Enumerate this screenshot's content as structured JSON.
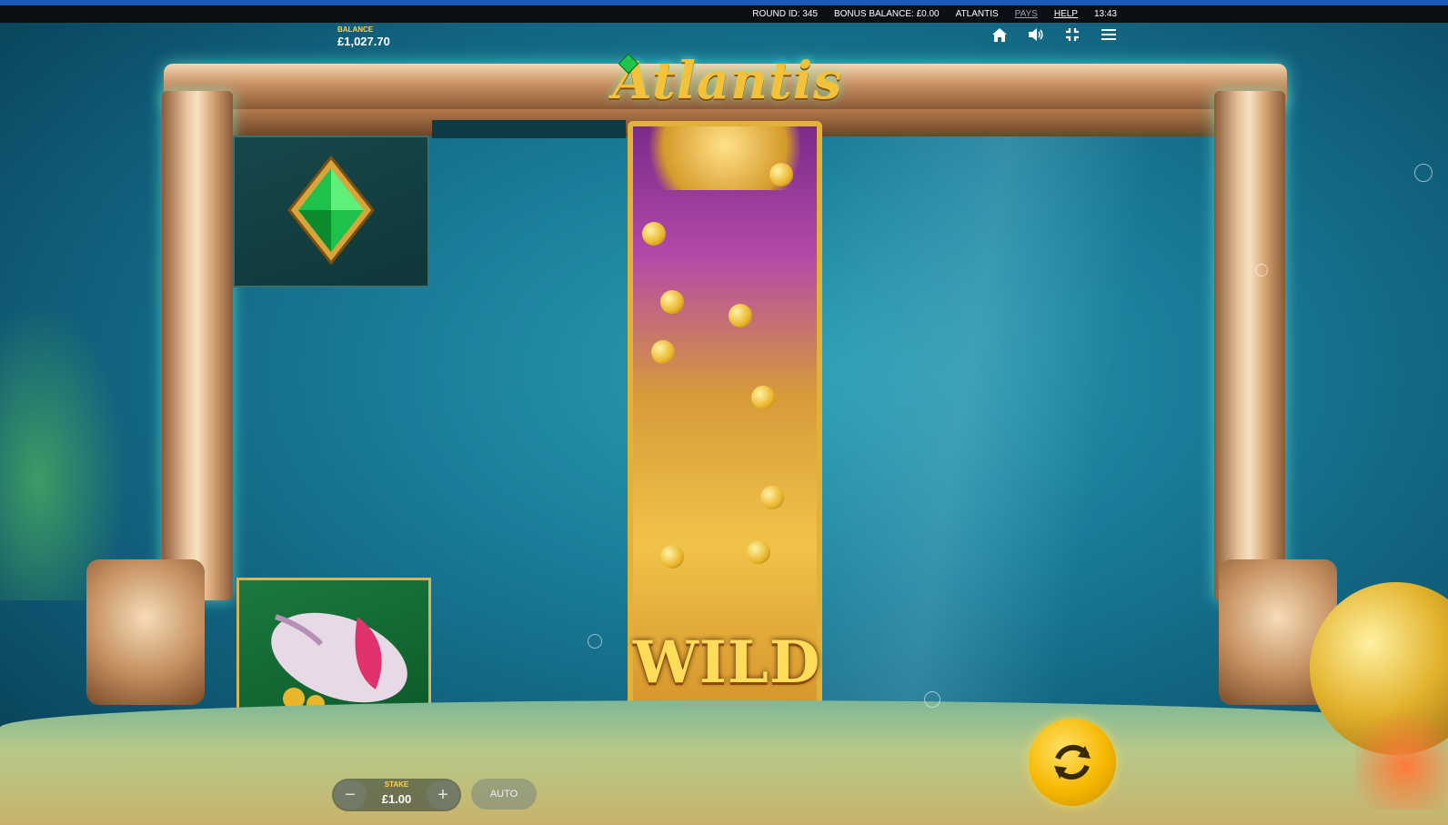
{
  "topbar": {
    "round_id": "ROUND ID: 345",
    "bonus_balance": "BONUS BALANCE: £0.00",
    "game_name": "ATLANTIS",
    "pays": "PAYS",
    "help": "HELP",
    "time": "13:43"
  },
  "balance": {
    "label": "BALANCE",
    "value": "£1,027.70"
  },
  "hud": {
    "icons": [
      "home-icon",
      "sound-icon",
      "fullscreen-exit-icon",
      "menu-icon"
    ]
  },
  "game": {
    "logo": "Atlantis",
    "reels": {
      "reel1_top_symbol": "green-gem-symbol",
      "reel1_bottom_symbol": "conch-shell-symbol",
      "reel3_symbol": "wild-symbol",
      "wild_label": "WILD"
    }
  },
  "controls": {
    "stake_label": "STAKE",
    "stake_value": "£1.00",
    "stake_minus": "−",
    "stake_plus": "+",
    "auto_label": "AUTO",
    "spin_icon": "spin-icon"
  },
  "colors": {
    "accent": "#f5b800",
    "topstrip": "#1a5bb5",
    "label_yellow": "#ffd34a"
  }
}
